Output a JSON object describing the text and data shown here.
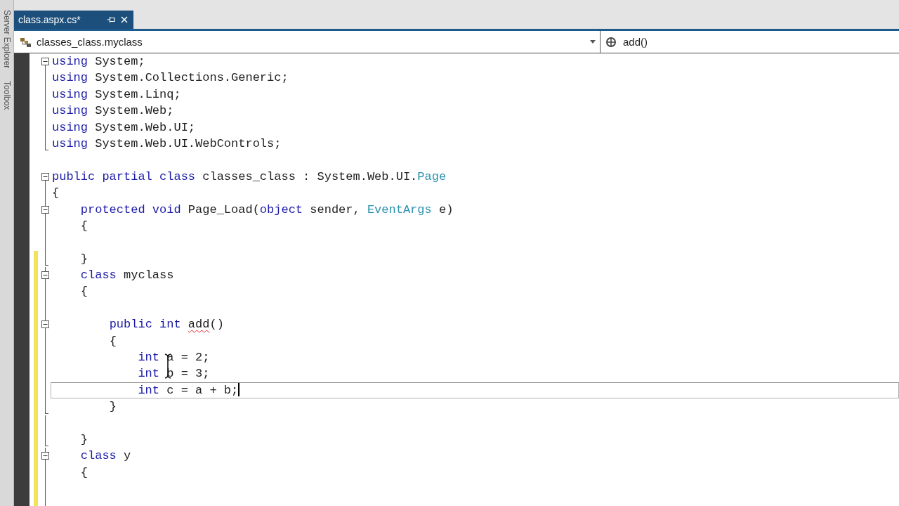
{
  "side_tabs": [
    {
      "label": "Server Explorer"
    },
    {
      "label": "Toolbox"
    }
  ],
  "tabs": [
    {
      "title": "class.aspx.cs*",
      "selected": true
    }
  ],
  "navigation_bar": {
    "type_dropdown": "classes_class.myclass",
    "member_dropdown": "add()"
  },
  "editor": {
    "lines": [
      {
        "tokens": [
          {
            "kind": "keyword",
            "text": "using"
          },
          {
            "kind": "plain",
            "text": " System;"
          }
        ],
        "outline": {
          "kind": "toggle",
          "expanded": true
        },
        "changed": false,
        "current": false
      },
      {
        "tokens": [
          {
            "kind": "keyword",
            "text": "using"
          },
          {
            "kind": "plain",
            "text": " System.Collections.Generic;"
          }
        ],
        "outline": {
          "kind": "line"
        },
        "changed": false,
        "current": false
      },
      {
        "tokens": [
          {
            "kind": "keyword",
            "text": "using"
          },
          {
            "kind": "plain",
            "text": " System.Linq;"
          }
        ],
        "outline": {
          "kind": "line"
        },
        "changed": false,
        "current": false
      },
      {
        "tokens": [
          {
            "kind": "keyword",
            "text": "using"
          },
          {
            "kind": "plain",
            "text": " System.Web;"
          }
        ],
        "outline": {
          "kind": "line"
        },
        "changed": false,
        "current": false
      },
      {
        "tokens": [
          {
            "kind": "keyword",
            "text": "using"
          },
          {
            "kind": "plain",
            "text": " System.Web.UI;"
          }
        ],
        "outline": {
          "kind": "line"
        },
        "changed": false,
        "current": false
      },
      {
        "tokens": [
          {
            "kind": "keyword",
            "text": "using"
          },
          {
            "kind": "plain",
            "text": " System.Web.UI.WebControls;"
          }
        ],
        "outline": {
          "kind": "end"
        },
        "changed": false,
        "current": false
      },
      {
        "changed": false,
        "current": false
      },
      {
        "tokens": [
          {
            "kind": "keyword",
            "text": "public partial class"
          },
          {
            "kind": "plain",
            "text": " classes_class : System.Web.UI."
          },
          {
            "kind": "type",
            "text": "Page"
          }
        ],
        "outline": {
          "kind": "toggle",
          "expanded": true
        },
        "changed": false,
        "current": false
      },
      {
        "tokens": [
          {
            "kind": "plain",
            "text": "{"
          }
        ],
        "outline": {
          "kind": "line"
        },
        "changed": false,
        "current": false
      },
      {
        "tokens": [
          {
            "kind": "keyword",
            "text": "    protected void"
          },
          {
            "kind": "plain",
            "text": " Page_Load("
          },
          {
            "kind": "keyword",
            "text": "object"
          },
          {
            "kind": "plain",
            "text": " sender, "
          },
          {
            "kind": "type",
            "text": "EventArgs"
          },
          {
            "kind": "plain",
            "text": " e)"
          }
        ],
        "outline": {
          "kind": "toggle",
          "expanded": true
        },
        "changed": false,
        "current": false
      },
      {
        "tokens": [
          {
            "kind": "plain",
            "text": "    {"
          }
        ],
        "outline": {
          "kind": "line"
        },
        "changed": false,
        "current": false
      },
      {
        "outline": {
          "kind": "line"
        },
        "changed": false,
        "current": false
      },
      {
        "tokens": [
          {
            "kind": "plain",
            "text": "    }"
          }
        ],
        "outline": {
          "kind": "end"
        },
        "changed": true,
        "current": false
      },
      {
        "tokens": [
          {
            "kind": "keyword",
            "text": "    class"
          },
          {
            "kind": "plain",
            "text": " myclass"
          }
        ],
        "outline": {
          "kind": "toggle",
          "expanded": true
        },
        "changed": true,
        "current": false
      },
      {
        "tokens": [
          {
            "kind": "plain",
            "text": "    {"
          }
        ],
        "outline": {
          "kind": "line"
        },
        "changed": true,
        "current": false
      },
      {
        "outline": {
          "kind": "line"
        },
        "changed": true,
        "current": false
      },
      {
        "tokens": [
          {
            "kind": "keyword",
            "text": "        public int "
          },
          {
            "kind": "error",
            "text": "add"
          },
          {
            "kind": "plain",
            "text": "()"
          }
        ],
        "outline": {
          "kind": "toggle",
          "expanded": true
        },
        "changed": true,
        "current": false
      },
      {
        "tokens": [
          {
            "kind": "plain",
            "text": "        {"
          }
        ],
        "outline": {
          "kind": "line"
        },
        "changed": true,
        "current": false
      },
      {
        "tokens": [
          {
            "kind": "keyword",
            "text": "            int"
          },
          {
            "kind": "plain",
            "text": " a = 2;"
          }
        ],
        "outline": {
          "kind": "line"
        },
        "changed": true,
        "current": false
      },
      {
        "tokens": [
          {
            "kind": "keyword",
            "text": "            int"
          },
          {
            "kind": "plain",
            "text": " b = 3;"
          }
        ],
        "outline": {
          "kind": "line"
        },
        "changed": true,
        "current": false
      },
      {
        "tokens": [
          {
            "kind": "keyword",
            "text": "            int"
          },
          {
            "kind": "plain",
            "text": " c = a + b;"
          }
        ],
        "outline": {
          "kind": "line"
        },
        "changed": true,
        "current": true
      },
      {
        "tokens": [
          {
            "kind": "plain",
            "text": "        }"
          }
        ],
        "outline": {
          "kind": "end"
        },
        "changed": true,
        "current": false
      },
      {
        "outline": {
          "kind": "line"
        },
        "changed": true,
        "current": false
      },
      {
        "tokens": [
          {
            "kind": "plain",
            "text": "    }"
          }
        ],
        "outline": {
          "kind": "end"
        },
        "changed": true,
        "current": false
      },
      {
        "tokens": [
          {
            "kind": "keyword",
            "text": "    class"
          },
          {
            "kind": "plain",
            "text": " y"
          }
        ],
        "outline": {
          "kind": "toggle",
          "expanded": true
        },
        "changed": true,
        "current": false
      },
      {
        "tokens": [
          {
            "kind": "plain",
            "text": "    {"
          }
        ],
        "outline": {
          "kind": "line"
        },
        "changed": true,
        "current": false
      },
      {
        "outline": {
          "kind": "line"
        },
        "changed": true,
        "current": false
      }
    ]
  }
}
